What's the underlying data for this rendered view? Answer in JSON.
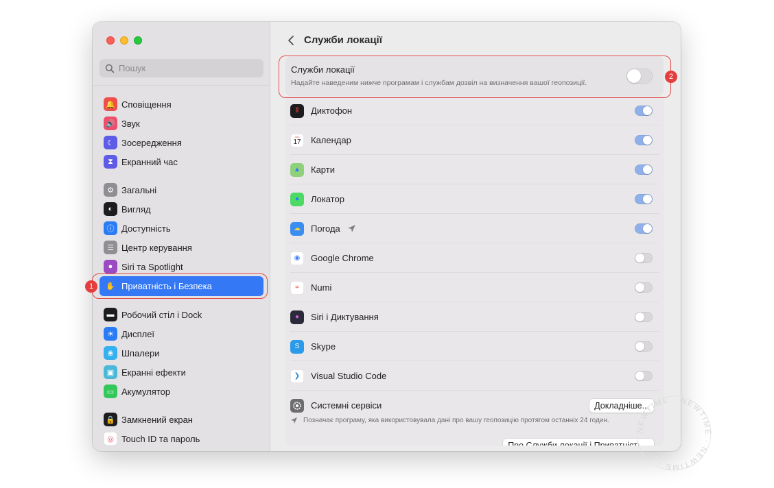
{
  "colors": {
    "accent": "#3478f6",
    "callout": "#e34b4b",
    "toggle_on": "#8fb0e8"
  },
  "search": {
    "placeholder": "Пошук"
  },
  "sidebar": {
    "groups": [
      [
        {
          "label": "Сповіщення",
          "icon": "bell-icon",
          "color": "#ef4e4a"
        },
        {
          "label": "Звук",
          "icon": "speaker-icon",
          "color": "#ef4e6a"
        },
        {
          "label": "Зосередження",
          "icon": "moon-icon",
          "color": "#5e5ce6"
        },
        {
          "label": "Екранний час",
          "icon": "hourglass-icon",
          "color": "#5e5ce6"
        }
      ],
      [
        {
          "label": "Загальні",
          "icon": "gear-icon",
          "color": "#8e8e93"
        },
        {
          "label": "Вигляд",
          "icon": "appearance-icon",
          "color": "#1d1d1f"
        },
        {
          "label": "Доступність",
          "icon": "accessibility-icon",
          "color": "#2a7cf6"
        },
        {
          "label": "Центр керування",
          "icon": "control-center-icon",
          "color": "#8e8e93"
        },
        {
          "label": "Siri та Spotlight",
          "icon": "siri-icon",
          "color": "#9b4ac4"
        },
        {
          "label": "Приватність і Безпека",
          "icon": "hand-icon",
          "color": "#3478f6",
          "active": true
        }
      ],
      [
        {
          "label": "Робочий стіл і Dock",
          "icon": "dock-icon",
          "color": "#1d1d1f"
        },
        {
          "label": "Дисплеї",
          "icon": "sun-icon",
          "color": "#2a7cf6"
        },
        {
          "label": "Шпалери",
          "icon": "wallpaper-icon",
          "color": "#35b1ef"
        },
        {
          "label": "Екранні ефекти",
          "icon": "screensaver-icon",
          "color": "#4cb8d8"
        },
        {
          "label": "Акумулятор",
          "icon": "battery-icon",
          "color": "#34c759"
        }
      ],
      [
        {
          "label": "Замкнений екран",
          "icon": "lock-icon",
          "color": "#1d1d1f"
        },
        {
          "label": "Touch ID та пароль",
          "icon": "fingerprint-icon",
          "color": "#ffffff"
        }
      ]
    ]
  },
  "header": {
    "title": "Служби локації"
  },
  "location_services": {
    "title": "Служби локації",
    "description": "Надайте наведеним нижче програмам і службам дозвіл на визначення вашої геопозиції.",
    "enabled": false
  },
  "apps": [
    {
      "name": "Диктофон",
      "icon": "voice-memos-icon",
      "enabled": true
    },
    {
      "name": "Календар",
      "icon": "calendar-icon",
      "enabled": true
    },
    {
      "name": "Карти",
      "icon": "maps-icon",
      "enabled": true
    },
    {
      "name": "Локатор",
      "icon": "find-my-icon",
      "enabled": true
    },
    {
      "name": "Погода",
      "icon": "weather-icon",
      "enabled": true,
      "recent": true
    },
    {
      "name": "Google Chrome",
      "icon": "chrome-icon",
      "enabled": false
    },
    {
      "name": "Numi",
      "icon": "numi-icon",
      "enabled": false
    },
    {
      "name": "Siri і Диктування",
      "icon": "siri-icon",
      "enabled": false
    },
    {
      "name": "Skype",
      "icon": "skype-icon",
      "enabled": false
    },
    {
      "name": "Visual Studio Code",
      "icon": "vscode-icon",
      "enabled": false
    }
  ],
  "calendar_icon": {
    "month": "JUL",
    "day": "17"
  },
  "system_services": {
    "name": "Системні сервіси",
    "button": "Докладніше..."
  },
  "note": "Позначає програму, яка використовувала дані про вашу геопозицію протягом останніх 24 годин.",
  "about_button": "Про Служби локації і Приватність...",
  "callouts": [
    {
      "number": "1"
    },
    {
      "number": "2"
    }
  ],
  "watermark": "NEWTIME"
}
